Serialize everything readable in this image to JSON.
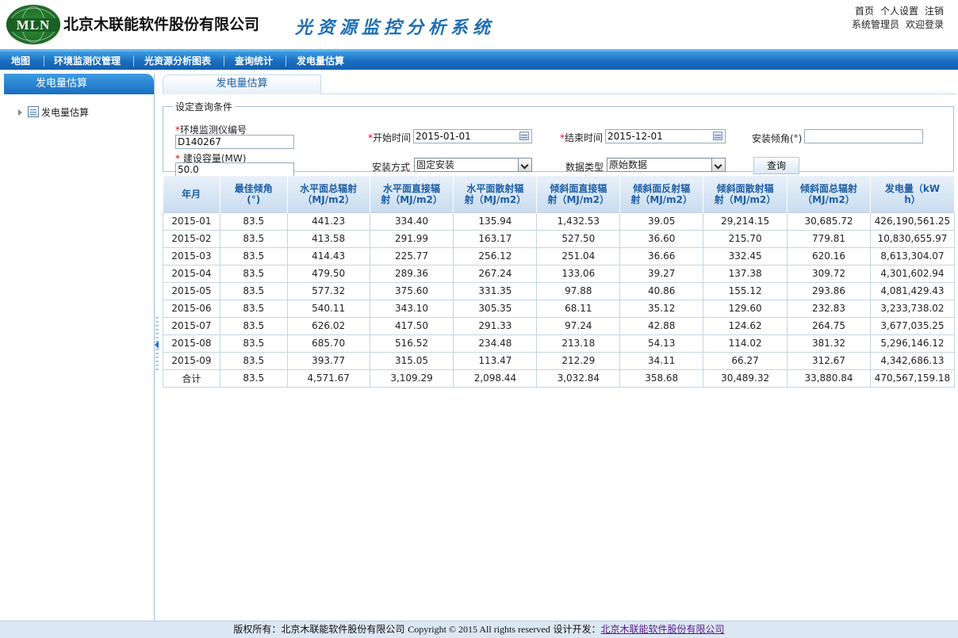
{
  "header": {
    "logo_text": "MLN",
    "company_name": "北京木联能软件股份有限公司",
    "system_title": "光资源监控分析系统",
    "links": [
      "首页",
      "个人设置",
      "注销"
    ],
    "user_name": "系统管理员",
    "welcome": "欢迎登录"
  },
  "nav": {
    "items": [
      "地图",
      "环境监测仪管理",
      "光资源分析图表",
      "查询统计",
      "发电量估算"
    ]
  },
  "left_panel": {
    "title": "发电量估算",
    "tree_item": "发电量估算"
  },
  "main": {
    "tab_label": "发电量估算",
    "query": {
      "legend": "设定查询条件",
      "monitor_id_label": "环境监测仪编号",
      "monitor_id_value": "D140267",
      "capacity_label": "建设容量(MW)",
      "capacity_value": "50.0",
      "start_label": "开始时间",
      "start_value": "2015-01-01",
      "end_label": "结束时间",
      "end_value": "2015-12-01",
      "tilt_label": "安装倾角(°)",
      "tilt_value": "",
      "mount_label": "安装方式",
      "mount_value": "固定安装",
      "datatype_label": "数据类型",
      "datatype_value": "原始数据",
      "query_button": "查询"
    },
    "table": {
      "headers": [
        [
          "年月"
        ],
        [
          "最佳倾角",
          "(°)"
        ],
        [
          "水平面总辐射",
          "（MJ/m2）"
        ],
        [
          "水平面直接辐",
          "射（MJ/m2）"
        ],
        [
          "水平面散射辐",
          "射（MJ/m2）"
        ],
        [
          "倾斜面直接辐",
          "射（MJ/m2）"
        ],
        [
          "倾斜面反射辐",
          "射（MJ/m2）"
        ],
        [
          "倾斜面散射辐",
          "射（MJ/m2）"
        ],
        [
          "倾斜面总辐射",
          "（MJ/m2）"
        ],
        [
          "发电量（kW",
          "h）"
        ]
      ],
      "rows": [
        [
          "2015-01",
          "83.5",
          "441.23",
          "334.40",
          "135.94",
          "1,432.53",
          "39.05",
          "29,214.15",
          "30,685.72",
          "426,190,561.25"
        ],
        [
          "2015-02",
          "83.5",
          "413.58",
          "291.99",
          "163.17",
          "527.50",
          "36.60",
          "215.70",
          "779.81",
          "10,830,655.97"
        ],
        [
          "2015-03",
          "83.5",
          "414.43",
          "225.77",
          "256.12",
          "251.04",
          "36.66",
          "332.45",
          "620.16",
          "8,613,304.07"
        ],
        [
          "2015-04",
          "83.5",
          "479.50",
          "289.36",
          "267.24",
          "133.06",
          "39.27",
          "137.38",
          "309.72",
          "4,301,602.94"
        ],
        [
          "2015-05",
          "83.5",
          "577.32",
          "375.60",
          "331.35",
          "97.88",
          "40.86",
          "155.12",
          "293.86",
          "4,081,429.43"
        ],
        [
          "2015-06",
          "83.5",
          "540.11",
          "343.10",
          "305.35",
          "68.11",
          "35.12",
          "129.60",
          "232.83",
          "3,233,738.02"
        ],
        [
          "2015-07",
          "83.5",
          "626.02",
          "417.50",
          "291.33",
          "97.24",
          "42.88",
          "124.62",
          "264.75",
          "3,677,035.25"
        ],
        [
          "2015-08",
          "83.5",
          "685.70",
          "516.52",
          "234.48",
          "213.18",
          "54.13",
          "114.02",
          "381.32",
          "5,296,146.12"
        ],
        [
          "2015-09",
          "83.5",
          "393.77",
          "315.05",
          "113.47",
          "212.29",
          "34.11",
          "66.27",
          "312.67",
          "4,342,686.13"
        ],
        [
          "合计",
          "83.5",
          "4,571.67",
          "3,109.29",
          "2,098.44",
          "3,032.84",
          "358.68",
          "30,489.32",
          "33,880.84",
          "470,567,159.18"
        ]
      ]
    }
  },
  "footer": {
    "prefix": "版权所有：北京木联能软件股份有限公司",
    "copyright": "Copyright © 2015 All rights reserved",
    "dev_label": "设计开发：",
    "dev_link": "北京木联能软件股份有限公司"
  }
}
